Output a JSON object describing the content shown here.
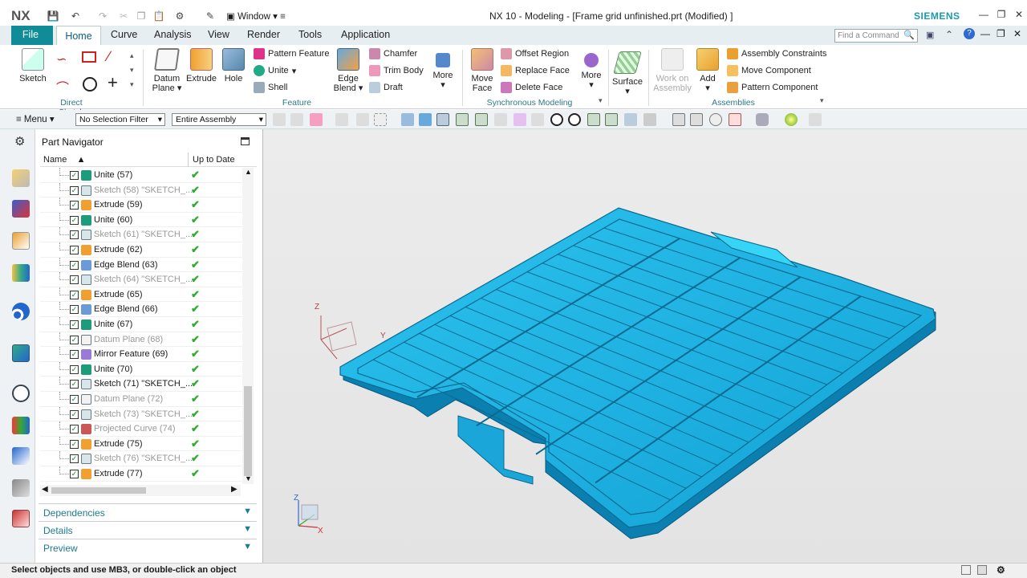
{
  "app": {
    "logo": "NX",
    "window_menu": "Window",
    "title": "NX 10 - Modeling - [Frame grid unfinished.prt (Modified) ]",
    "brand": "SIEMENS"
  },
  "menu": {
    "tabs": [
      "File",
      "Home",
      "Curve",
      "Analysis",
      "View",
      "Render",
      "Tools",
      "Application"
    ],
    "search_placeholder": "Find a Command"
  },
  "ribbon": {
    "direct_sketch": {
      "label": "Direct Sketch",
      "sketch": "Sketch"
    },
    "feature": {
      "label": "Feature",
      "datum_plane": "Datum Plane",
      "extrude": "Extrude",
      "hole": "Hole",
      "pattern_feature": "Pattern Feature",
      "unite": "Unite",
      "shell": "Shell",
      "edge_blend": "Edge Blend",
      "chamfer": "Chamfer",
      "trim_body": "Trim Body",
      "draft": "Draft",
      "more": "More"
    },
    "sync": {
      "label": "Synchronous Modeling",
      "move_face": "Move Face",
      "offset_region": "Offset Region",
      "replace_face": "Replace Face",
      "delete_face": "Delete Face",
      "more": "More"
    },
    "surface": {
      "label": "Surface"
    },
    "assemblies": {
      "label": "Assemblies",
      "work_on_assembly": "Work on Assembly",
      "add": "Add",
      "assembly_constraints": "Assembly Constraints",
      "move_component": "Move Component",
      "pattern_component": "Pattern Component"
    }
  },
  "toolbar": {
    "menu": "Menu",
    "selection_filter": "No Selection Filter",
    "scope": "Entire Assembly"
  },
  "navigator": {
    "title": "Part Navigator",
    "col_name": "Name",
    "col_uptodate": "Up to Date",
    "rows": [
      {
        "label": "Unite (57)",
        "icon": "unite",
        "dim": false
      },
      {
        "label": "Sketch (58) \"SKETCH_...",
        "icon": "sketch",
        "dim": true
      },
      {
        "label": "Extrude (59)",
        "icon": "extrude",
        "dim": false
      },
      {
        "label": "Unite (60)",
        "icon": "unite",
        "dim": false
      },
      {
        "label": "Sketch (61) \"SKETCH_...",
        "icon": "sketch",
        "dim": true
      },
      {
        "label": "Extrude (62)",
        "icon": "extrude",
        "dim": false
      },
      {
        "label": "Edge Blend (63)",
        "icon": "blend",
        "dim": false
      },
      {
        "label": "Sketch (64) \"SKETCH_...",
        "icon": "sketch",
        "dim": true
      },
      {
        "label": "Extrude (65)",
        "icon": "extrude",
        "dim": false
      },
      {
        "label": "Edge Blend (66)",
        "icon": "blend",
        "dim": false
      },
      {
        "label": "Unite (67)",
        "icon": "unite",
        "dim": false
      },
      {
        "label": "Datum Plane (68)",
        "icon": "datum",
        "dim": true
      },
      {
        "label": "Mirror Feature (69)",
        "icon": "mirror",
        "dim": false
      },
      {
        "label": "Unite (70)",
        "icon": "unite",
        "dim": false
      },
      {
        "label": "Sketch (71) \"SKETCH_...",
        "icon": "sketch",
        "dim": false
      },
      {
        "label": "Datum Plane (72)",
        "icon": "datum",
        "dim": true
      },
      {
        "label": "Sketch (73) \"SKETCH_...",
        "icon": "sketch",
        "dim": true
      },
      {
        "label": "Projected Curve (74)",
        "icon": "curve",
        "dim": true
      },
      {
        "label": "Extrude (75)",
        "icon": "extrude",
        "dim": false
      },
      {
        "label": "Sketch (76) \"SKETCH_...",
        "icon": "sketch",
        "dim": true
      },
      {
        "label": "Extrude (77)",
        "icon": "extrude",
        "dim": false
      }
    ],
    "sections": [
      "Dependencies",
      "Details",
      "Preview"
    ]
  },
  "status": "Select objects and use MB3, or double-click an object",
  "colors": {
    "accent": "#0f8c97",
    "model": "#22b8e6"
  }
}
